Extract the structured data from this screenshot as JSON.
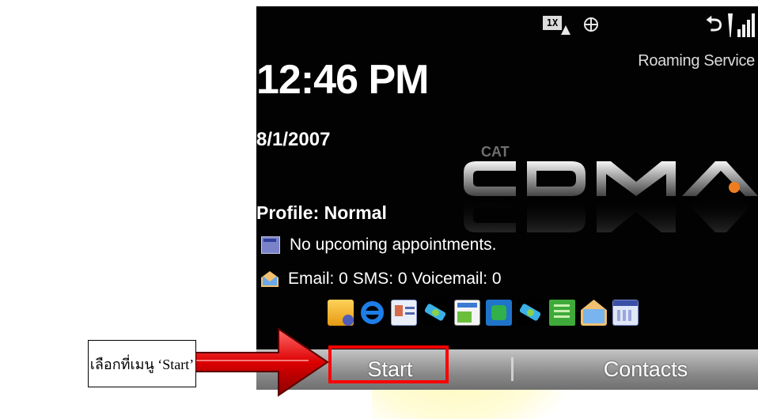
{
  "status": {
    "network_badge": "1X",
    "roaming_text": "Roaming Service"
  },
  "home": {
    "clock": "12:46 PM",
    "date": "8/1/2007",
    "logo": {
      "brand_small": "CAT",
      "brand_main": "CDMA"
    },
    "profile": "Profile: Normal",
    "appointments": "No upcoming appointments.",
    "messages": "Email: 0 SMS: 0 Voicemail: 0",
    "apps": [
      "folder-icon",
      "internet-explorer-icon",
      "contact-card-icon",
      "satellite-icon",
      "messaging-window-icon",
      "media-icon",
      "satellite-icon",
      "green-document-icon",
      "envelope-icon",
      "calendar-icon"
    ]
  },
  "softkeys": {
    "left": "Start",
    "right": "Contacts"
  },
  "annotation": {
    "callout_text": "เลือกที่เมนู ‘Start’",
    "highlight_color": "#ff0000",
    "arrow_color": "#cc0000"
  }
}
